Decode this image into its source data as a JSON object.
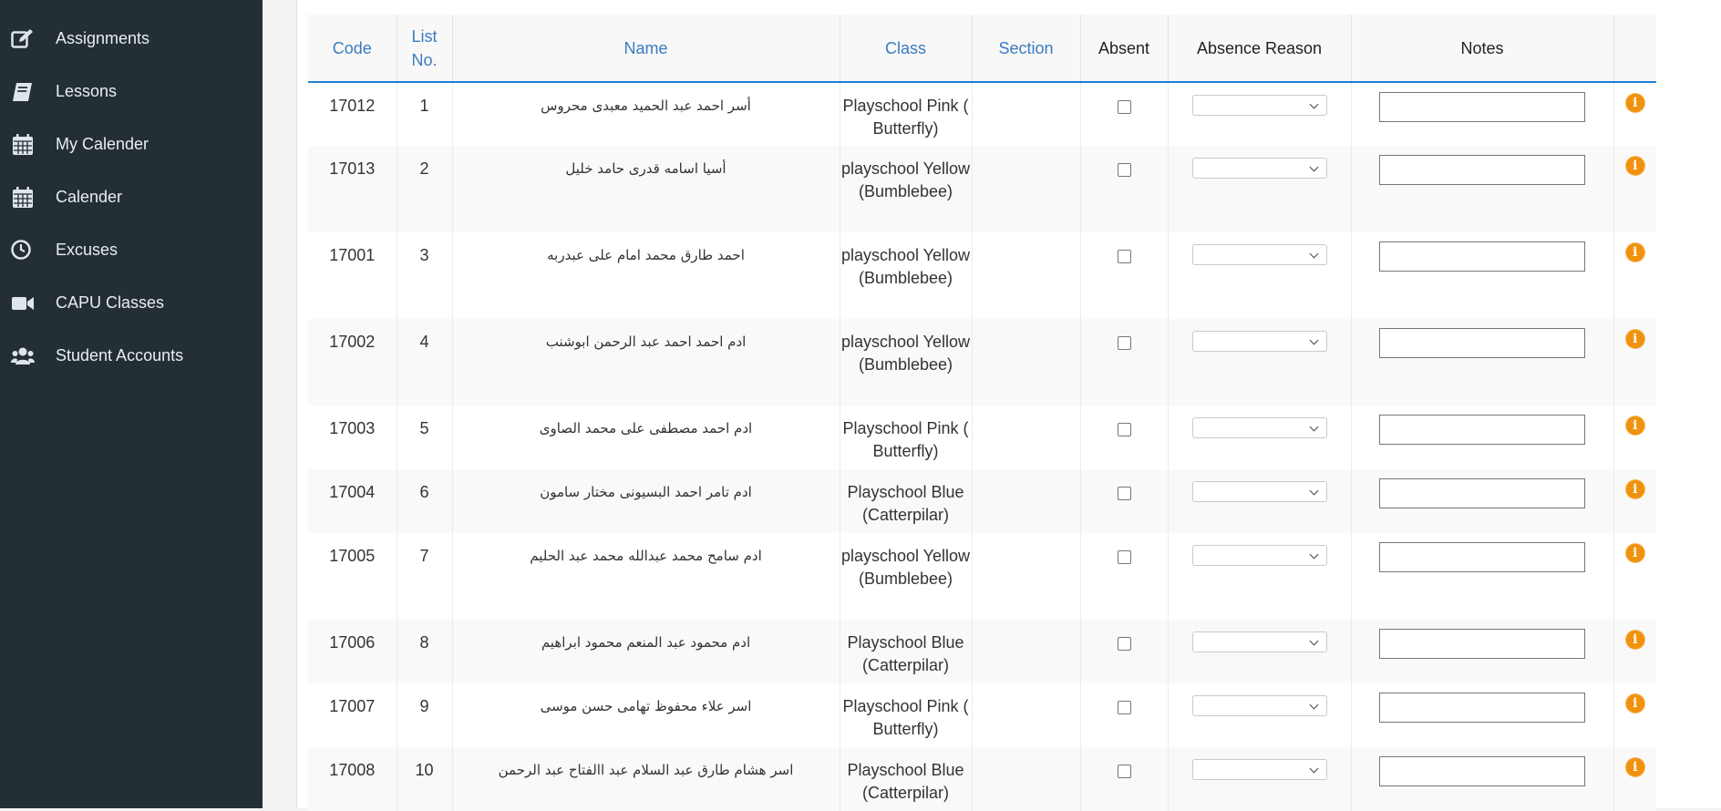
{
  "sidebar": {
    "items": [
      {
        "label": "Assignments",
        "icon": "edit-icon"
      },
      {
        "label": "Lessons",
        "icon": "book-icon"
      },
      {
        "label": "My Calender",
        "icon": "calendar-icon"
      },
      {
        "label": "Calender",
        "icon": "calendar-icon"
      },
      {
        "label": "Excuses",
        "icon": "clock-icon"
      },
      {
        "label": "CAPU Classes",
        "icon": "video-camera-icon"
      },
      {
        "label": "Student Accounts",
        "icon": "users-icon"
      }
    ]
  },
  "table": {
    "headers": {
      "code": "Code",
      "list_no": "List No.",
      "name": "Name",
      "class": "Class",
      "section": "Section",
      "absent": "Absent",
      "absence_reason": "Absence Reason",
      "notes": "Notes"
    },
    "header_link_color": "#3a7cc0",
    "accent_color": "#1f7fd3",
    "info_icon_color": "#f0920d",
    "rows": [
      {
        "code": "17012",
        "list_no": "1",
        "name": "أسر احمد عبد الحميد معبدى محروس",
        "class": "Playschool Pink ( Butterfly)"
      },
      {
        "code": "17013",
        "list_no": "2",
        "name": "أسيا اسامه قدرى حامد خليل",
        "class": "playschool Yellow (Bumblebee)"
      },
      {
        "code": "17001",
        "list_no": "3",
        "name": "احمد طارق محمد امام على عبدربه",
        "class": "playschool Yellow (Bumblebee)"
      },
      {
        "code": "17002",
        "list_no": "4",
        "name": "ادم احمد احمد عبد الرحمن ابوشنب",
        "class": "playschool Yellow (Bumblebee)"
      },
      {
        "code": "17003",
        "list_no": "5",
        "name": "ادم احمد مصطفى على محمد الصاوى",
        "class": "Playschool Pink ( Butterfly)"
      },
      {
        "code": "17004",
        "list_no": "6",
        "name": "ادم تامر احمد البسيونى مختار سامون",
        "class": "Playschool Blue (Catterpilar)"
      },
      {
        "code": "17005",
        "list_no": "7",
        "name": "ادم سامح محمد عبدالله محمد عبد الحليم",
        "class": "playschool Yellow (Bumblebee)"
      },
      {
        "code": "17006",
        "list_no": "8",
        "name": "ادم محمود عبد المنعم محمود ابراهيم",
        "class": "Playschool Blue (Catterpilar)"
      },
      {
        "code": "17007",
        "list_no": "9",
        "name": "اسر علاء محفوظ تهامى حسن موسى",
        "class": "Playschool Pink ( Butterfly)"
      },
      {
        "code": "17008",
        "list_no": "10",
        "name": "اسر هشام طارق عبد السلام عبد االفتاح عبد الرحمن",
        "class": "Playschool Blue (Catterpilar)"
      }
    ]
  }
}
